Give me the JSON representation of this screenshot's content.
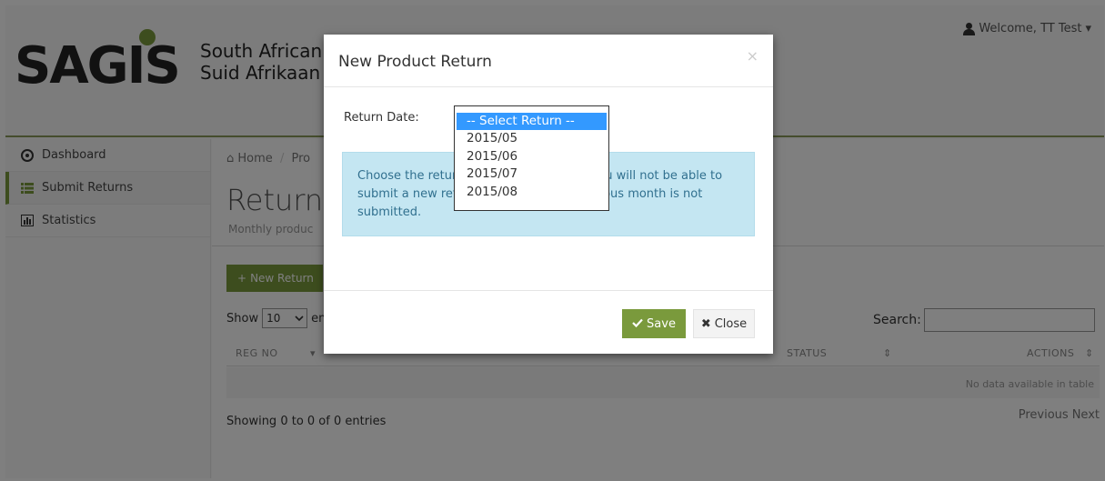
{
  "header": {
    "logo_text": "SAGIS",
    "tagline_line1": "South African",
    "tagline_line2": "Suid Afrikaan",
    "user_menu": "Welcome, TT Test",
    "user_caret": "▾"
  },
  "sidebar": {
    "items": [
      {
        "label": "Dashboard",
        "icon": "dashboard-icon"
      },
      {
        "label": "Submit Returns",
        "icon": "list-icon"
      },
      {
        "label": "Statistics",
        "icon": "chart-icon"
      }
    ]
  },
  "main": {
    "breadcrumb_home": "Home",
    "breadcrumb_sep": "/",
    "breadcrumb_current": "Pro",
    "title": "Returns",
    "subtitle": "Monthly produc",
    "new_button": "New Return",
    "show_label": "Show",
    "show_value": "10",
    "entries_label": "en",
    "search_label": "Search:",
    "search_value": "",
    "columns": {
      "reg_no": "REG NO",
      "status": "STATUS",
      "actions": "ACTIONS"
    },
    "empty_text": "No data available in table",
    "showing_text": "Showing 0 to 0 of 0 entries",
    "prev_label": "Previous",
    "next_label": "Next"
  },
  "modal": {
    "title": "New Product Return",
    "close_symbol": "×",
    "return_date_label": "Return Date:",
    "info_line1": "Choose the retur                                    You will not be able to",
    "info_line2": "submit a new ret                                    vious month is not",
    "info_line3": "submitted.",
    "save_label": "Save",
    "close_label": "Close"
  },
  "return_select": {
    "options": [
      "-- Select Return --",
      "2015/05",
      "2015/06",
      "2015/07",
      "2015/08"
    ],
    "selected_index": 0
  },
  "colors": {
    "brand_green": "#7a9a3c",
    "info_bg": "#c4e6f2",
    "info_text": "#31708f",
    "select_highlight": "#3399ff"
  }
}
